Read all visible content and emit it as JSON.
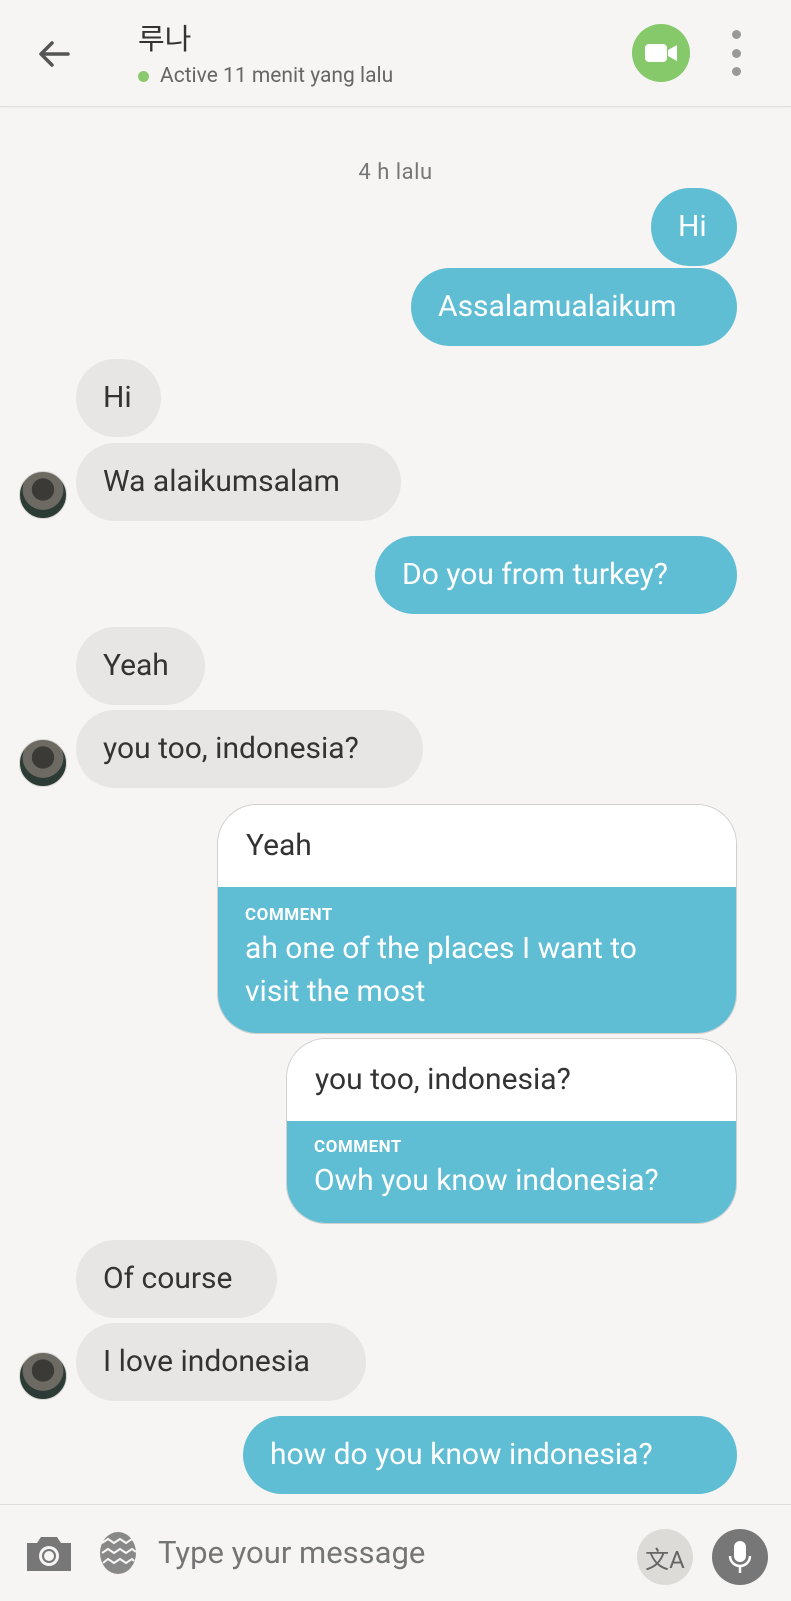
{
  "header": {
    "title": "루나",
    "status": "Active 11 menit yang lalu"
  },
  "chat": {
    "timestamp": "4 h lalu",
    "messages": [
      {
        "from": "me",
        "text": "Hi"
      },
      {
        "from": "me",
        "text": "Assalamualaikum"
      },
      {
        "from": "them",
        "text": "Hi"
      },
      {
        "from": "them",
        "text": "Wa alaikumsalam"
      },
      {
        "from": "me",
        "text": "Do you from turkey?"
      },
      {
        "from": "them",
        "text": "Yeah"
      },
      {
        "from": "them",
        "text": "you too, indonesia?"
      },
      {
        "from": "me",
        "type": "comment",
        "quote": "Yeah",
        "label": "COMMENT",
        "text_lines": [
          "ah one of the places I want to",
          "visit the most"
        ]
      },
      {
        "from": "me",
        "type": "comment",
        "quote": "you too, indonesia?",
        "label": "COMMENT",
        "text": "Owh you know indonesia?"
      },
      {
        "from": "them",
        "text": "Of course"
      },
      {
        "from": "them",
        "text": "I love indonesia"
      },
      {
        "from": "me",
        "text": "how do you know indonesia?"
      }
    ]
  },
  "composer": {
    "placeholder": "Type your message",
    "translate_glyph": "文A"
  },
  "colors": {
    "outgoing": "#5fbdd4",
    "incoming": "#e8e6e4",
    "online": "#8bc96f",
    "video": "#85c96a"
  }
}
